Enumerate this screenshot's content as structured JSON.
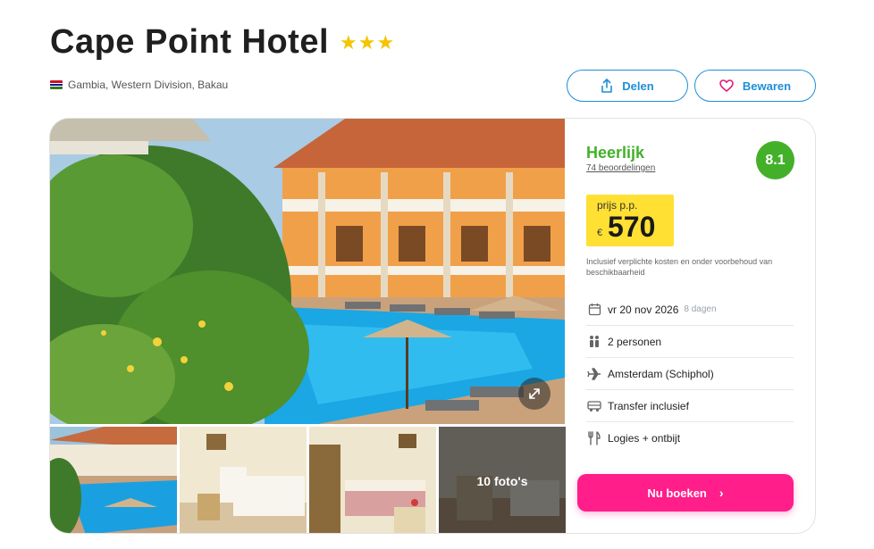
{
  "hotel": {
    "name": "Cape Point Hotel",
    "stars": "★★★",
    "location": "Gambia, Western Division, Bakau"
  },
  "actions": {
    "share_label": "Delen",
    "save_label": "Bewaren"
  },
  "gallery": {
    "more_photos_label": "10 foto's"
  },
  "rating": {
    "word": "Heerlijk",
    "reviews": "74 beoordelingen",
    "score": "8.1"
  },
  "price": {
    "label": "prijs p.p.",
    "currency": "€",
    "value": "570",
    "note": "Inclusief verplichte kosten en onder voorbehoud van beschikbaarheid"
  },
  "details": {
    "date": "vr 20 nov 2026",
    "duration": "8 dagen",
    "persons": "2 personen",
    "departure": "Amsterdam (Schiphol)",
    "transfer": "Transfer inclusief",
    "board": "Logies + ontbijt"
  },
  "booking": {
    "button_label": "Nu boeken"
  },
  "colors": {
    "accent_blue": "#1f8fd6",
    "rating_green": "#43b02a",
    "price_yellow": "#ffe033",
    "book_pink": "#ff1e8a",
    "star_yellow": "#f5c400"
  }
}
